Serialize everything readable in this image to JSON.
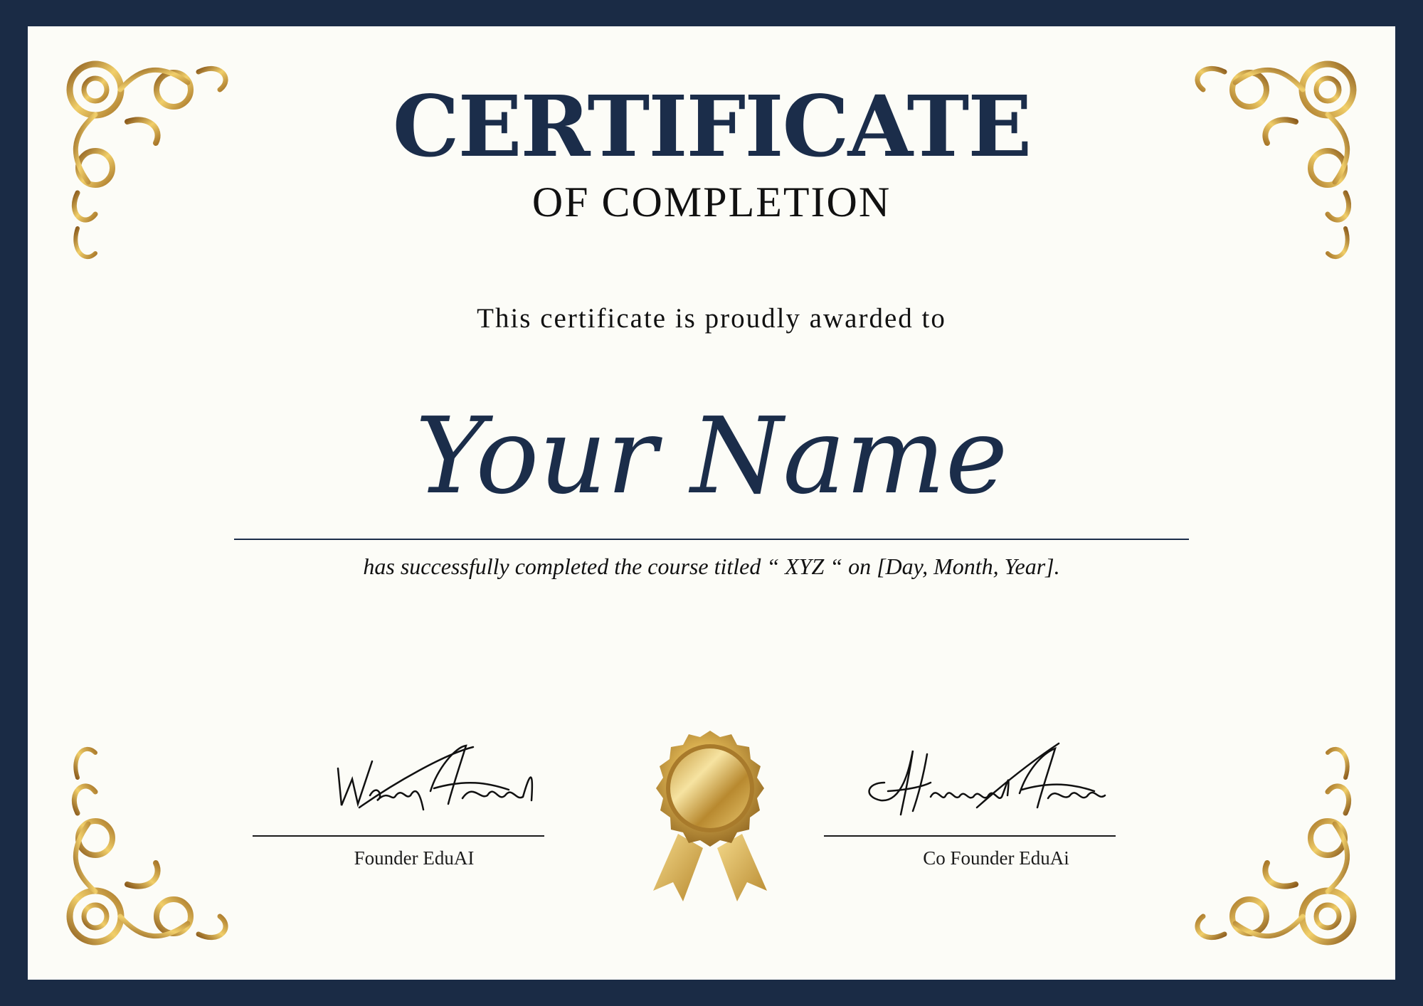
{
  "colors": {
    "frame": "#1a2b45",
    "paper": "#fcfcf7",
    "navy_text": "#1b2d4a",
    "gold": "#c9a24a"
  },
  "certificate": {
    "title": "CERTIFICATE",
    "subtitle": "OF COMPLETION",
    "awarded_text": "This certificate is proudly awarded to",
    "recipient_name": "Your Name",
    "course_text": "has successfully completed the course titled “ XYZ “ on [Day, Month, Year]."
  },
  "signatures": {
    "left": {
      "signature_text": "Waqar Ahmad",
      "role": "Founder EduAI"
    },
    "right": {
      "signature_text": "Hammad Ahmad",
      "role": "Co Founder EduAi"
    }
  },
  "decorations": {
    "corner_ornament_icon": "gold-flourish-icon",
    "seal_icon": "gold-award-seal-icon"
  }
}
